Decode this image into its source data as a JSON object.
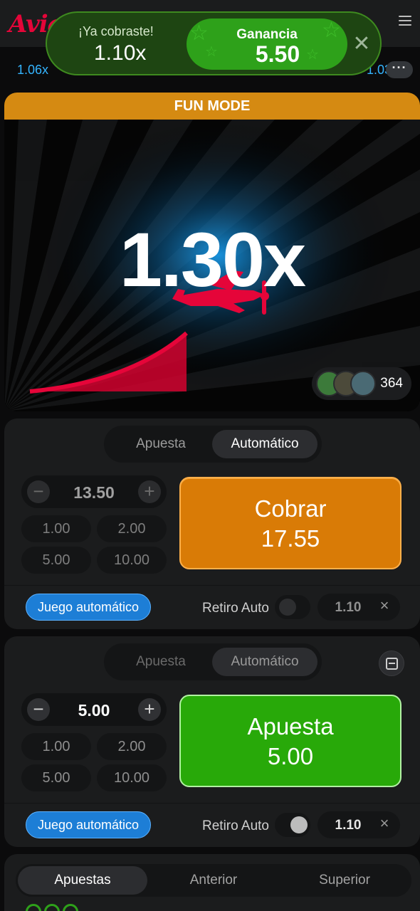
{
  "header": {
    "logo_text": "Avia",
    "menu_icon": "hamburger-menu-icon"
  },
  "history": {
    "first": "1.06x",
    "last": "1.03",
    "more_label": "···"
  },
  "toast": {
    "label": "¡Ya cobraste!",
    "multiplier": "1.10x",
    "win_label": "Ganancia",
    "win_value": "5.50",
    "close_label": "✕"
  },
  "game": {
    "mode_label": "FUN MODE",
    "multiplier": "1.30x",
    "players_count": "364",
    "colors": {
      "accent_red": "#e50539",
      "fun_bar": "#d58a12"
    }
  },
  "panel1": {
    "tabs": [
      "Apuesta",
      "Automático"
    ],
    "active_tab": "Automático",
    "stepper": {
      "minus": "−",
      "value": "13.50",
      "plus": "+"
    },
    "quick_amounts": [
      "1.00",
      "2.00",
      "5.00",
      "10.00"
    ],
    "action": {
      "line1": "Cobrar",
      "line2": "17.55"
    },
    "auto_play_label": "Juego automático",
    "auto_cashout_label": "Retiro Auto",
    "auto_cashout_enabled": false,
    "auto_cashout_value": "1.10",
    "clear_label": "×"
  },
  "panel2": {
    "tabs": [
      "Apuesta",
      "Automático"
    ],
    "active_tab": "Automático",
    "collapse_icon": "minus-square-icon",
    "stepper": {
      "minus": "−",
      "value": "5.00",
      "plus": "+"
    },
    "quick_amounts": [
      "1.00",
      "2.00",
      "5.00",
      "10.00"
    ],
    "action": {
      "line1": "Apuesta",
      "line2": "5.00"
    },
    "auto_play_label": "Juego automático",
    "auto_cashout_label": "Retiro Auto",
    "auto_cashout_enabled": true,
    "auto_cashout_value": "1.10",
    "clear_label": "×"
  },
  "bottom_tabs": {
    "items": [
      "Apuestas",
      "Anterior",
      "Superior"
    ],
    "active": "Apuestas"
  }
}
